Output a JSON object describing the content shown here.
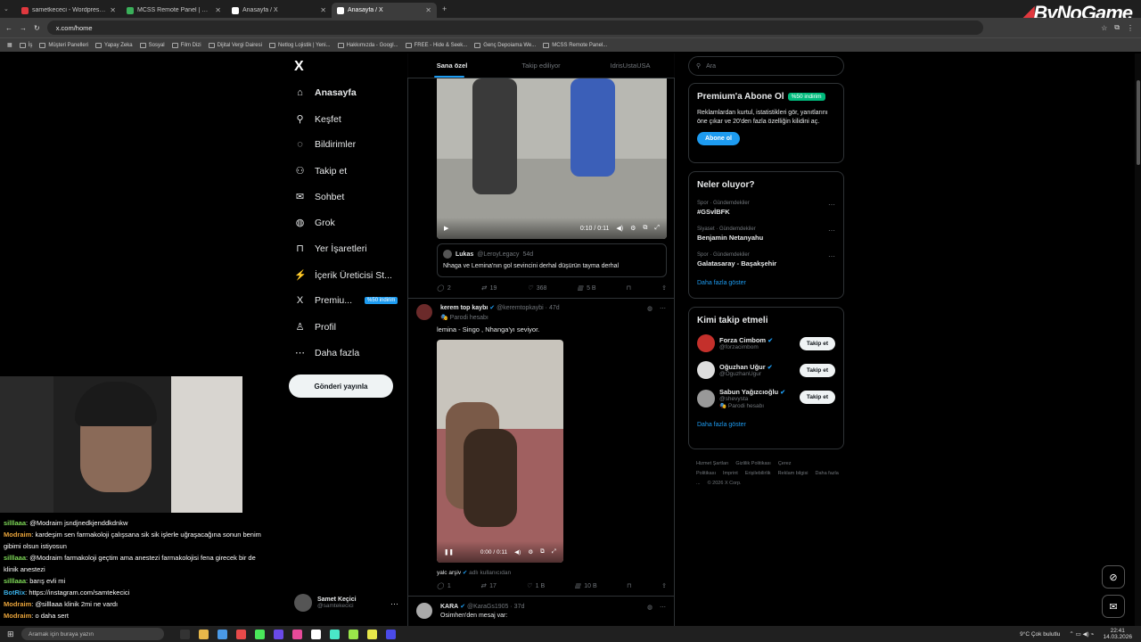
{
  "browser": {
    "tabs": [
      {
        "title": "sametkececi - Wordpress Uzman",
        "color": "#e0383e",
        "active": false
      },
      {
        "title": "MCSS Remote Panel | Servers",
        "color": "#3ab05a",
        "active": false
      },
      {
        "title": "Anasayfa / X",
        "color": "#ffffff",
        "active": false
      },
      {
        "title": "Anasayfa / X",
        "color": "#ffffff",
        "active": true
      }
    ],
    "url": "x.com/home",
    "bookmarks": [
      "İş",
      "Müşteri Panelleri",
      "Yapay Zeka",
      "Sosyal",
      "Film Dizi",
      "Dijital Vergi Dairesi",
      "Netlog Lojistik | Yeni...",
      "Hakkımızda - Googl...",
      "FREE - Hide & Seek...",
      "Genç Depoiama We...",
      "MCSS Remote Panel..."
    ],
    "brand": "ByNoGame"
  },
  "nav": {
    "logo": "X",
    "items": [
      {
        "label": "Anasayfa",
        "icon": "home-icon",
        "glyph": "⌂"
      },
      {
        "label": "Keşfet",
        "icon": "search-icon",
        "glyph": "⚲"
      },
      {
        "label": "Bildirimler",
        "icon": "bell-icon",
        "glyph": "◌"
      },
      {
        "label": "Takip et",
        "icon": "follow-icon",
        "glyph": "⚇"
      },
      {
        "label": "Sohbet",
        "icon": "mail-icon",
        "glyph": "✉"
      },
      {
        "label": "Grok",
        "icon": "grok-icon",
        "glyph": "◍"
      },
      {
        "label": "Yer İşaretleri",
        "icon": "bookmark-icon",
        "glyph": "⊓"
      },
      {
        "label": "İçerik Üreticisi St...",
        "icon": "creator-icon",
        "glyph": "⚡"
      },
      {
        "label": "Premiu...",
        "icon": "x-premium-icon",
        "glyph": "X"
      },
      {
        "label": "Profil",
        "icon": "profile-icon",
        "glyph": "♙"
      },
      {
        "label": "Daha fazla",
        "icon": "more-icon",
        "glyph": "⋯"
      }
    ],
    "premium_badge": "%50 indirim",
    "post_button": "Gönderi yayınla",
    "profile": {
      "name": "Samet Keçici",
      "handle": "@samtekecici"
    }
  },
  "chat": [
    {
      "user": "silllaaa",
      "sep": ": ",
      "text": "@Modraim jsndjnedkjenddkdnkw",
      "cls": "u1"
    },
    {
      "user": "Modraim",
      "sep": ": ",
      "text": "kardeşim sen farmakoloji çalışsana sik sik işlerle uğraşacağına sonun benim gibimi olsun istiyosun",
      "cls": "u2"
    },
    {
      "user": "silllaaa",
      "sep": ": ",
      "text": "@Modraim farmakoloji geçtim ama anestezi farmakolojisi fena girecek bir de klinik anestezi",
      "cls": "u1"
    },
    {
      "user": "silllaaa",
      "sep": ": ",
      "text": "barış evli mi",
      "cls": "u1"
    },
    {
      "user": "BotRix",
      "sep": ": ",
      "text": "https://instagram.com/samtekecici",
      "cls": "u3"
    },
    {
      "user": "Modraim",
      "sep": ": ",
      "text": "@silllaaa klinik 2mi ne vardı",
      "cls": "u2"
    },
    {
      "user": "Modraim",
      "sep": ": ",
      "text": "o daha sert",
      "cls": "u2"
    }
  ],
  "feed": {
    "tabs": [
      "Sana özel",
      "Takip ediliyor",
      "IdrisUstaUSA"
    ],
    "tweet1": {
      "video_time": "0:10 / 0:11",
      "quote": {
        "name": "Lukas",
        "handle": "@LeroyLegacy",
        "time": "54d",
        "text": "Nhaga ve Lemina'nın gol sevincini derhal düşürün tayma derhal"
      },
      "stats": {
        "replies": "2",
        "reposts": "19",
        "likes": "368",
        "views": "5 B"
      }
    },
    "tweet2": {
      "name": "kerem top kaybı",
      "handle": "@keremtopkaybi",
      "time": "47d",
      "parody": "Parodi hesabı",
      "text": "lemina - Singo , Nhanga'yı seviyor.",
      "video_time": "0:00 / 0:11",
      "caption_name": "yalc arşiv",
      "caption_suffix": "adlı kullanıcıdan",
      "stats": {
        "replies": "1",
        "reposts": "17",
        "likes": "1 B",
        "views": "10 B"
      }
    },
    "tweet3": {
      "name": "KARA",
      "handle": "@KaraGs1905",
      "time": "37d",
      "text": "Osimhen'den mesaj var:"
    }
  },
  "sidebar": {
    "search_placeholder": "Ara",
    "premium": {
      "title": "Premium'a Abone Ol",
      "badge": "%50 indirim",
      "text": "Reklamlardan kurtul, istatistikleri gör, yanıtlarını öne çıkar ve 20'den fazla özelliğin kilidini aç.",
      "button": "Abone ol"
    },
    "trends": {
      "title": "Neler oluyor?",
      "items": [
        {
          "meta": "Spor · Gündemdekiler",
          "name": "#GSvİBFK"
        },
        {
          "meta": "Siyaset · Gündemdekiler",
          "name": "Benjamin Netanyahu"
        },
        {
          "meta": "Spor · Gündemdekiler",
          "name": "Galatasaray - Başakşehir"
        }
      ],
      "show_more": "Daha fazla göster"
    },
    "who_to_follow": {
      "title": "Kimi takip etmeli",
      "users": [
        {
          "name": "Forza Cimbom",
          "handle": "@forzacimbom",
          "color": "#c4302b",
          "extra": ""
        },
        {
          "name": "Oğuzhan Uğur",
          "handle": "@OguzhanUgur",
          "color": "#dddddd",
          "extra": ""
        },
        {
          "name": "Sabun Yağızcıoğlu",
          "handle": "@shevysta",
          "color": "#999999",
          "extra": "Parodi hesabı"
        }
      ],
      "follow_label": "Takip et",
      "show_more": "Daha fazla göster"
    },
    "footer": [
      "Hizmet Şartları",
      "Gizlilik Politikası",
      "Çerez Politikası",
      "Imprint",
      "Erişilebilirlik",
      "Reklam bilgisi",
      "Daha fazla ...",
      "© 2026 X Corp."
    ]
  },
  "taskbar": {
    "search": "Aramak için buraya yazın",
    "weather": "9°C  Çok bulutlu",
    "time": "22:41",
    "date": "14.03.2026",
    "app_colors": [
      "#333",
      "#e8b84a",
      "#4a9ae8",
      "#e84a4a",
      "#4ae85a",
      "#6a4ae8",
      "#e84a9a",
      "#fff",
      "#4ae8c8",
      "#9ae84a",
      "#e8e84a",
      "#4a4ae8"
    ]
  }
}
